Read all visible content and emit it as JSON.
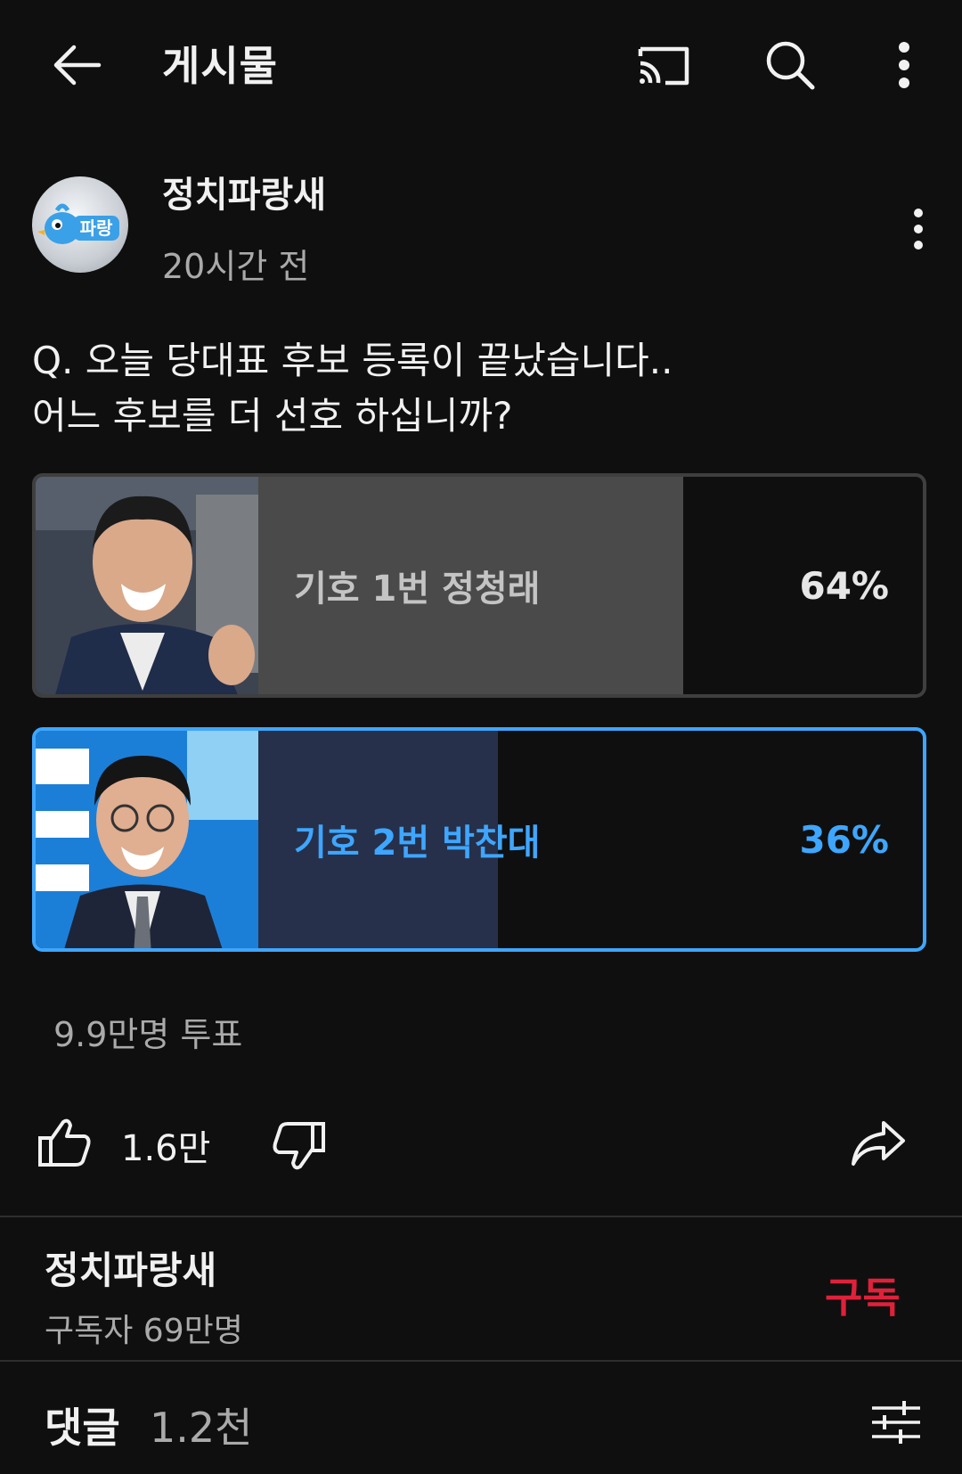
{
  "header": {
    "title": "게시물",
    "icons": [
      "back-arrow-icon",
      "cast-icon",
      "search-icon",
      "more-vert-icon"
    ]
  },
  "post": {
    "channel_name": "정치파랑새",
    "avatar_text": "파랑",
    "time": "20시간 전",
    "question_line1": "Q. 오늘 당대표 후보 등록이 끝났습니다..",
    "question_line2": "어느 후보를 더 선호 하십니까?"
  },
  "poll": {
    "options": [
      {
        "label": "기호 1번 정청래",
        "percent_text": "64%",
        "percent": 64,
        "selected": false
      },
      {
        "label": "기호 2번 박찬대",
        "percent_text": "36%",
        "percent": 36,
        "selected": true
      }
    ],
    "votes": "9.9만명 투표"
  },
  "actions": {
    "like_count": "1.6만"
  },
  "subscription": {
    "channel_name": "정치파랑새",
    "subscriber_count": "구독자 69만명",
    "subscribe_label": "구독"
  },
  "comments": {
    "label": "댓글",
    "count": "1.2천"
  },
  "colors": {
    "background": "#0f0f0f",
    "accent_blue": "#3ea6ff",
    "subscribe_red": "#e0213a"
  }
}
